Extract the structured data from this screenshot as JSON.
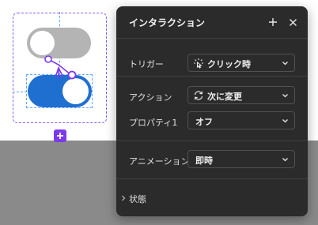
{
  "panel": {
    "title": "インタラクション",
    "add_icon": "plus-icon",
    "close_icon": "close-icon",
    "trigger": {
      "label": "トリガー",
      "value": "クリック時",
      "icon": "tap-icon"
    },
    "action": {
      "label": "アクション",
      "value": "次に変更",
      "icon": "swap-arrows-icon"
    },
    "property": {
      "label": "プロパティ1",
      "value": "オフ"
    },
    "animation": {
      "label": "アニメーション",
      "value": "即時"
    },
    "state_section": {
      "label": "状態"
    }
  },
  "colors": {
    "panel_bg": "#2b2b2b",
    "toggle_on": "#1f6fd1",
    "toggle_off": "#b4b4b4",
    "frame_purple": "#8b5cf6",
    "prototype_connector": "#7c3aed"
  }
}
